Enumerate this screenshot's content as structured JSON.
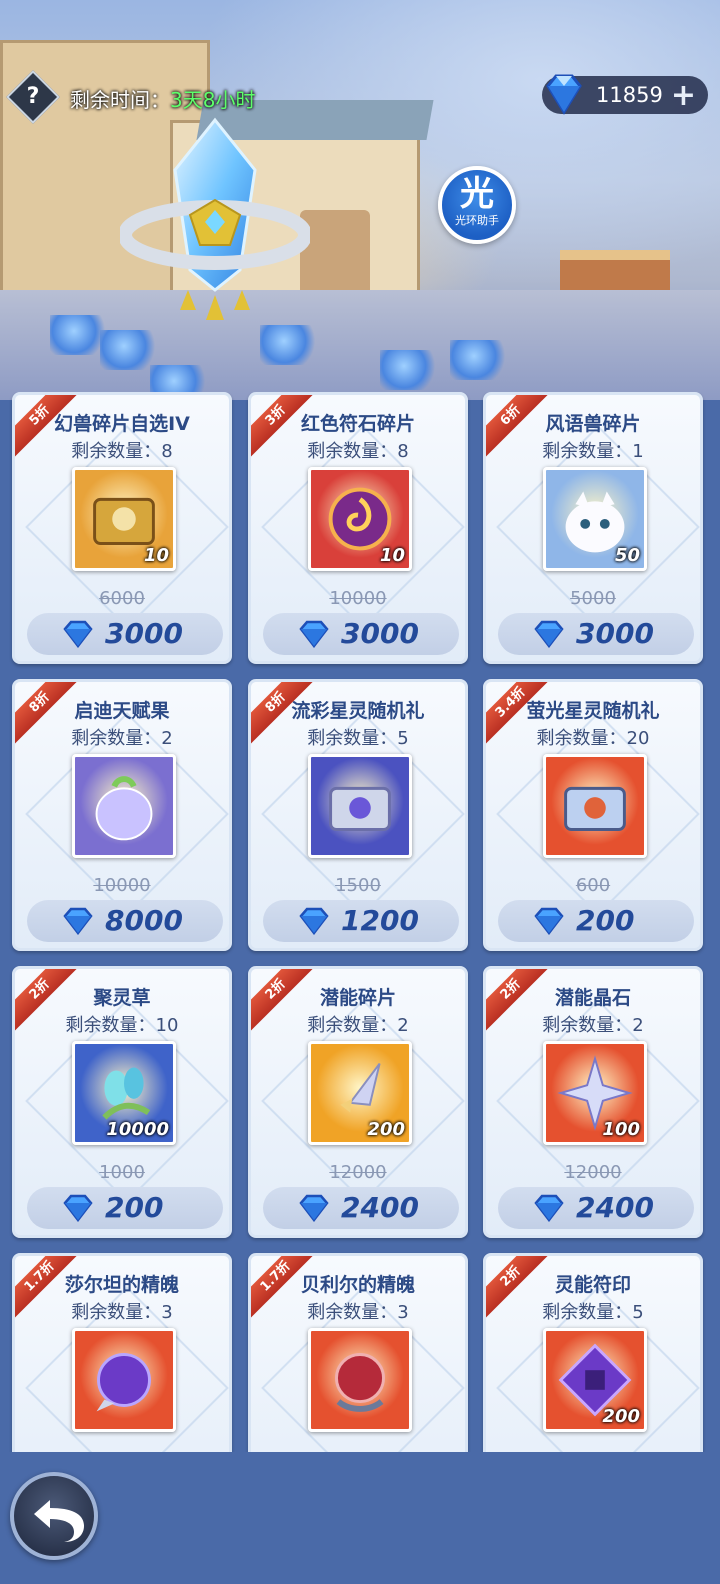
{
  "header": {
    "timer_label": "剩余时间：",
    "timer_value": "3天8小时",
    "currency_amount": "11859",
    "help_icon": "question-icon",
    "add_icon": "plus-icon",
    "helper_big": "光",
    "helper_small": "光环助手"
  },
  "items": [
    {
      "discount": "5折",
      "name": "幻兽碎片自选IV",
      "remain": "剩余数量：8",
      "qty": "10",
      "orig": "6000",
      "price": "3000",
      "icon": "treasure-chest-icon",
      "bg": "#e8a33a"
    },
    {
      "discount": "3折",
      "name": "红色符石碎片",
      "remain": "剩余数量：8",
      "qty": "10",
      "orig": "10000",
      "price": "3000",
      "icon": "red-rune-icon",
      "bg": "#d9403a"
    },
    {
      "discount": "6折",
      "name": "风语兽碎片",
      "remain": "剩余数量：1",
      "qty": "50",
      "orig": "5000",
      "price": "3000",
      "icon": "white-cat-icon",
      "bg": "#8fb6e8"
    },
    {
      "discount": "8折",
      "name": "启迪天赋果",
      "remain": "剩余数量：2",
      "qty": "",
      "orig": "10000",
      "price": "8000",
      "icon": "crystal-fruit-icon",
      "bg": "#7b6fd0"
    },
    {
      "discount": "8折",
      "name": "流彩星灵随机礼",
      "remain": "剩余数量：5",
      "qty": "",
      "orig": "1500",
      "price": "1200",
      "icon": "silver-chest-icon",
      "bg": "#4b52c0"
    },
    {
      "discount": "3.4折",
      "name": "萤光星灵随机礼",
      "remain": "剩余数量：20",
      "qty": "",
      "orig": "600",
      "price": "200",
      "icon": "blue-chest-icon",
      "bg": "#e5512f"
    },
    {
      "discount": "2折",
      "name": "聚灵草",
      "remain": "剩余数量：10",
      "qty": "10000",
      "orig": "1000",
      "price": "200",
      "icon": "herb-icon",
      "bg": "#3f63c9"
    },
    {
      "discount": "2折",
      "name": "潜能碎片",
      "remain": "剩余数量：2",
      "qty": "200",
      "orig": "12000",
      "price": "2400",
      "icon": "shard-icon",
      "bg": "#f0a326"
    },
    {
      "discount": "2折",
      "name": "潜能晶石",
      "remain": "剩余数量：2",
      "qty": "100",
      "orig": "12000",
      "price": "2400",
      "icon": "star-crystal-icon",
      "bg": "#e5512f"
    },
    {
      "discount": "1.7折",
      "name": "莎尔坦的精魄",
      "remain": "剩余数量：3",
      "qty": "",
      "orig": "",
      "price": "",
      "icon": "purple-orb-icon",
      "bg": "#e5512f"
    },
    {
      "discount": "1.7折",
      "name": "贝利尔的精魄",
      "remain": "剩余数量：3",
      "qty": "",
      "orig": "",
      "price": "",
      "icon": "red-orb-icon",
      "bg": "#e5512f"
    },
    {
      "discount": "2折",
      "name": "灵能符印",
      "remain": "剩余数量：5",
      "qty": "200",
      "orig": "",
      "price": "",
      "icon": "purple-seal-icon",
      "bg": "#e5512f"
    }
  ],
  "colors": {
    "ribbon": "#c9402e",
    "price_text": "#234a9a",
    "timer_value": "#5dff6a"
  }
}
